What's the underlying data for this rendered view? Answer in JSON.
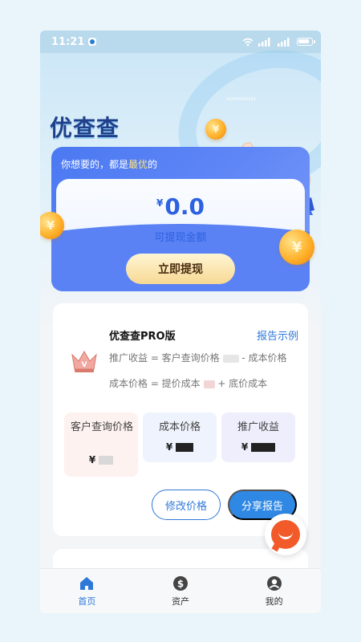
{
  "status_bar": {
    "time": "11:21"
  },
  "hero": {
    "app_name": "优查查",
    "arrows": "‹‹‹‹‹‹‹‹‹‹‹‹"
  },
  "wallet": {
    "tagline_prefix": "你想要的，都是",
    "tagline_highlight": "最优",
    "tagline_suffix": "的",
    "currency": "¥",
    "amount": "0.0",
    "amount_label": "可提现金额",
    "withdraw_button": "立即提现"
  },
  "pro": {
    "title": "优查查PRO版",
    "report_example": "报告示例",
    "formula1_a": "推广收益 = 客户查询价格 ",
    "formula1_b": " - 成本价格",
    "formula2_a": "成本价格 = 提价成本 ",
    "formula2_b": " + 底价成本",
    "boxes": [
      {
        "label": "客户查询价格",
        "currency": "¥"
      },
      {
        "label": "成本价格",
        "currency": "¥"
      },
      {
        "label": "推广收益",
        "currency": "¥"
      }
    ],
    "modify_button": "修改价格",
    "share_button": "分享报告"
  },
  "tabs": [
    {
      "label": "首页",
      "icon": "home-icon"
    },
    {
      "label": "资产",
      "icon": "dollar-icon"
    },
    {
      "label": "我的",
      "icon": "user-icon"
    }
  ],
  "colors": {
    "accent": "#2f78d8",
    "wallet_blue": "#4b79f2",
    "gold": "#f7d893",
    "float_orange": "#f25a2a"
  }
}
